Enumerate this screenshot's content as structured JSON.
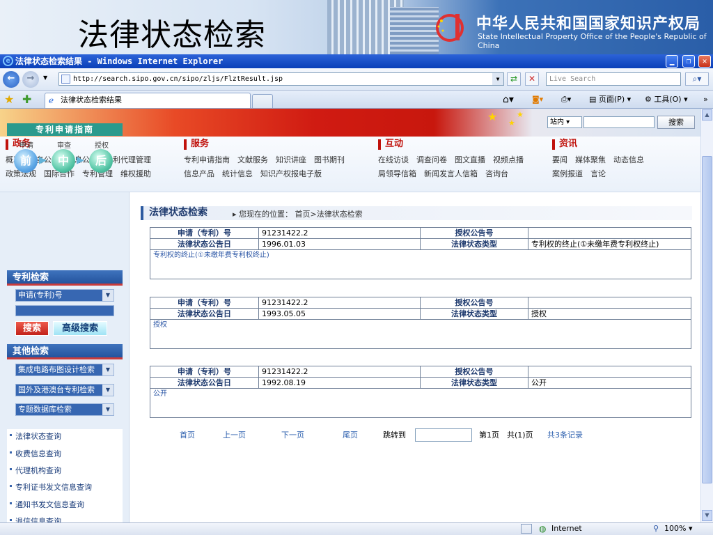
{
  "banner": {
    "title": "法律状态检索",
    "org_cn": "中华人民共和国国家知识产权局",
    "org_en": "State Intellectual Property Office of the People's Republic of China"
  },
  "browser": {
    "window_title": "法律状态检索结果 - Windows Internet Explorer",
    "url": "http://search.sipo.gov.cn/sipo/zljs/FlztResult.jsp",
    "search_placeholder": "Live Search",
    "tab_title": "法律状态检索结果",
    "toolbar": {
      "page_label": "页面(P)",
      "tools_label": "工具(O)"
    },
    "status": {
      "zone": "Internet",
      "zoom": "100%"
    }
  },
  "site": {
    "search": {
      "scope": "站内",
      "button": "搜索"
    },
    "nav": [
      {
        "title": "政务",
        "rows": [
          [
            "概况",
            "政务公示",
            "信息公开",
            "专利代理管理"
          ],
          [
            "政策法规",
            "国际合作",
            "专利管理",
            "维权援助"
          ]
        ]
      },
      {
        "title": "服务",
        "rows": [
          [
            "专利申请指南",
            "文献服务",
            "知识讲座",
            "图书期刊"
          ],
          [
            "信息产品",
            "统计信息",
            "知识产权报电子版"
          ]
        ]
      },
      {
        "title": "互动",
        "rows": [
          [
            "在线访谈",
            "调查问卷",
            "图文直播",
            "视频点播"
          ],
          [
            "局领导信箱",
            "新闻发言人信箱",
            "咨询台"
          ]
        ]
      },
      {
        "title": "资讯",
        "rows": [
          [
            "要闻",
            "媒体聚焦",
            "动态信息"
          ],
          [
            "案例报道",
            "言论"
          ]
        ]
      }
    ]
  },
  "sidebar": {
    "guide_title": "专利申请指南",
    "stages": [
      {
        "label": "申请",
        "glyph": "前"
      },
      {
        "label": "审查",
        "glyph": "中"
      },
      {
        "label": "授权",
        "glyph": "后"
      }
    ],
    "patent_search": {
      "title": "专利检索",
      "select": "申请(专利)号",
      "search_btn": "搜索",
      "adv_btn": "高级搜索"
    },
    "other_search": {
      "title": "其他检索",
      "selects": [
        "集成电路布图设计检索",
        "国外及港澳台专利检索",
        "专题数据库检索"
      ]
    },
    "links": [
      "法律状态查询",
      "收费信息查询",
      "代理机构查询",
      "专利证书发文信息查询",
      "通知书发文信息查询",
      "退信信息查询"
    ]
  },
  "main": {
    "heading": "法律状态检索",
    "location": "您现在的位置：  首页>法律状态检索",
    "labels": {
      "app_no": "申请（专利）号",
      "grant_no": "授权公告号",
      "date": "法律状态公告日",
      "type": "法律状态类型"
    },
    "records": [
      {
        "app_no": "91231422.2",
        "grant_no": "",
        "date": "1996.01.03",
        "type": "专利权的终止(①未缴年费专利权终止)",
        "desc": "专利权的终止(①未缴年费专利权终止)"
      },
      {
        "app_no": "91231422.2",
        "grant_no": "",
        "date": "1993.05.05",
        "type": "授权",
        "desc": "授权"
      },
      {
        "app_no": "91231422.2",
        "grant_no": "",
        "date": "1992.08.19",
        "type": "公开",
        "desc": "公开"
      }
    ],
    "pager": {
      "first": "首页",
      "prev": "上一页",
      "next": "下一页",
      "last": "尾页",
      "jump": "跳转到",
      "page": "第1页",
      "total": "共(1)页",
      "records": "共3条记录"
    }
  },
  "colors": {
    "ie_blue": "#0a3fb8",
    "site_red": "#c0120c",
    "nav_blue": "#24549e"
  }
}
